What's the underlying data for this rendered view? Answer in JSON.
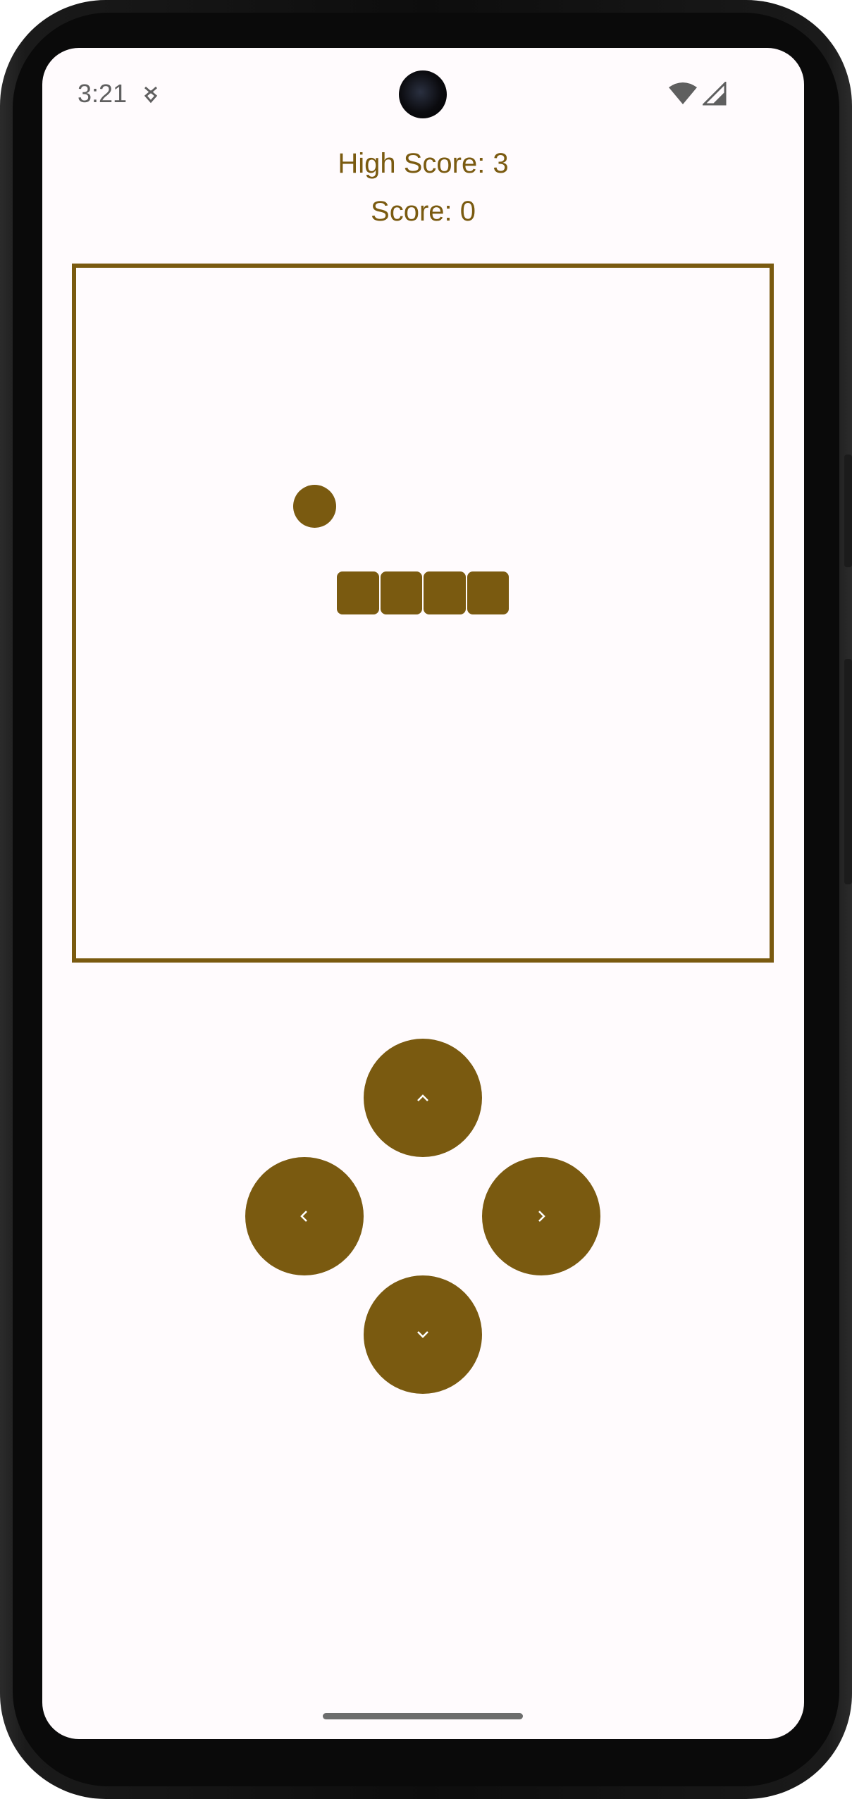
{
  "status_bar": {
    "time": "3:21",
    "icons": [
      "notification-icon",
      "wifi-icon",
      "cellular-signal-icon"
    ]
  },
  "scores": {
    "high_score": "High Score: 3",
    "score": "Score: 0"
  },
  "game": {
    "board_cells": 16,
    "food_cell": {
      "col": 5,
      "row": 5
    },
    "snake_cells": [
      {
        "col": 6,
        "row": 7
      },
      {
        "col": 7,
        "row": 7
      },
      {
        "col": 8,
        "row": 7
      },
      {
        "col": 9,
        "row": 7
      }
    ]
  },
  "controls": {
    "up": "chevron-up-icon",
    "left": "chevron-left-icon",
    "right": "chevron-right-icon",
    "down": "chevron-down-icon"
  },
  "colors": {
    "accent": "#7a5a10",
    "background": "#fffbfd",
    "status_text": "#5f5f5f"
  }
}
